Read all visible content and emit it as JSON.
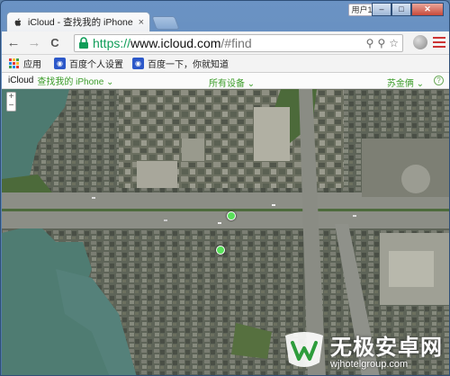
{
  "browser": {
    "tab_title": "iCloud - 查找我的 iPhone",
    "tab_close": "×",
    "user_badge": "用户1",
    "win_minimize": "–",
    "win_maximize": "□",
    "win_close": "✕"
  },
  "toolbar": {
    "back": "←",
    "forward": "→",
    "reload": "C",
    "url_scheme": "https://",
    "url_host": "www.icloud.com",
    "url_rest": "/#find"
  },
  "bookmarks": {
    "apps_label": "应用",
    "items": [
      {
        "label": "百度个人设置"
      },
      {
        "label": "百度一下，你就知道"
      }
    ]
  },
  "icloud": {
    "brand": "iCloud",
    "app_name": "查找我的 iPhone",
    "all_devices": "所有设备",
    "user_name": "苏金俩",
    "help": "?"
  },
  "map": {
    "zoom_in": "+",
    "zoom_out": "−"
  },
  "watermark": {
    "title": "无极安卓网",
    "url": "wjhotelgroup.com"
  },
  "colors": {
    "accent_green": "#3c9d2a",
    "https_green": "#0f9d58",
    "pin_green": "#59e15a"
  }
}
